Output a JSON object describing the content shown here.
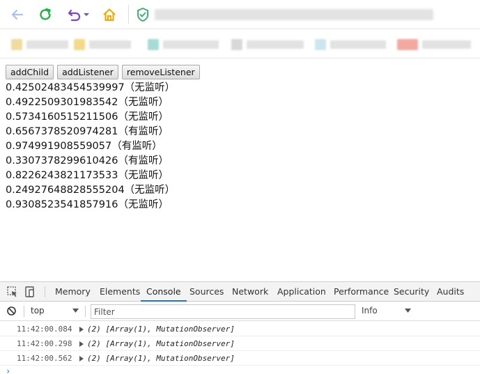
{
  "browser": {
    "icons": {
      "back": "arrow-left-icon",
      "reload": "refresh-icon",
      "undo": "undo-icon",
      "home": "home-icon",
      "secure": "shield-check-icon"
    },
    "colors": {
      "back": "#a9c2f5",
      "reload": "#19b545",
      "undo": "#7b44c9",
      "home": "#f2a900",
      "secure": "#3cb371"
    }
  },
  "page": {
    "buttons": [
      {
        "label": "addChild"
      },
      {
        "label": "addListener"
      },
      {
        "label": "removeListener"
      }
    ],
    "lines": [
      "0.42502483454539997（无监听）",
      "0.4922509301983542（无监听）",
      "0.5734160515211506（无监听）",
      "0.6567378520974281（有监听）",
      "0.974991908559057（有监听）",
      "0.3307378299610426（有监听）",
      "0.8226243821173533（无监听）",
      "0.24927648828555204（无监听）",
      "0.9308523541857916（无监听）"
    ]
  },
  "devtools": {
    "tabs": [
      "Memory",
      "Elements",
      "Console",
      "Sources",
      "Network",
      "Application",
      "Performance",
      "Security",
      "Audits"
    ],
    "active_tab": "Console",
    "context": "top",
    "filter_placeholder": "Filter",
    "level": "Info",
    "logs": [
      {
        "time": "11:42:00.084",
        "message": "(2) [Array(1), MutationObserver]"
      },
      {
        "time": "11:42:00.298",
        "message": "(2) [Array(1), MutationObserver]"
      },
      {
        "time": "11:42:00.562",
        "message": "(2) [Array(1), MutationObserver]"
      }
    ],
    "prompt": "›",
    "accent": "#1a73e8"
  }
}
